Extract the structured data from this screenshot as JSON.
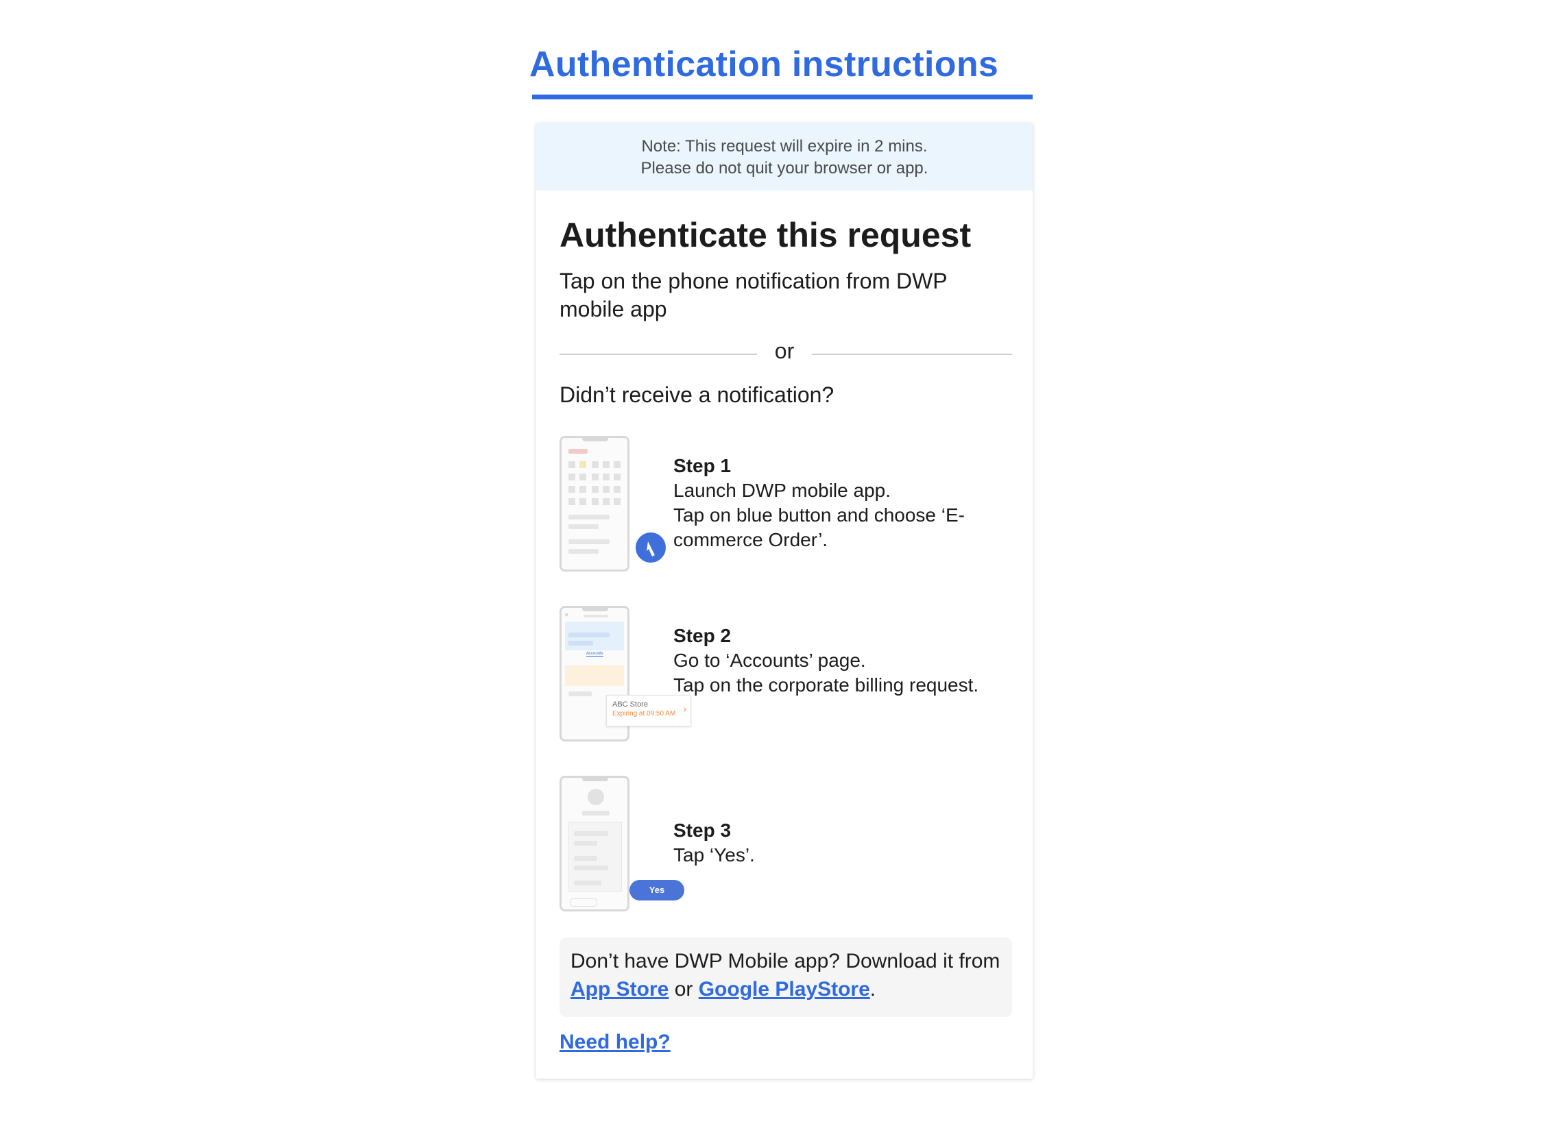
{
  "page": {
    "title": "Authentication instructions"
  },
  "note": {
    "line1": "Note: This request will expire in 2 mins.",
    "line2": "Please do not quit your browser or app."
  },
  "card": {
    "heading": "Authenticate this request",
    "subheading": "Tap on the phone notification from DWP mobile app",
    "divider": "or",
    "question": "Didn’t receive a notification?"
  },
  "steps": [
    {
      "title": "Step 1",
      "lines": [
        "Launch DWP mobile app.",
        "Tap on blue button and choose ‘E-commerce Order’."
      ]
    },
    {
      "title": "Step 2",
      "lines": [
        "Go to ‘Accounts’ page.",
        "Tap on the corporate billing request."
      ],
      "illustration": {
        "tab_label": "Accounts",
        "card_title": "ABC Store",
        "card_subtitle": "Expiring at 09:50 AM",
        "card_chevron": "›"
      }
    },
    {
      "title": "Step 3",
      "lines": [
        "Tap ‘Yes’."
      ],
      "illustration": {
        "button_label": "Yes"
      }
    }
  ],
  "download": {
    "text_before": "Don’t have DWP Mobile app? Download it from",
    "app_store": "App Store",
    "or": "or",
    "play_store": "Google PlayStore",
    "period": "."
  },
  "help": {
    "label": "Need help?"
  },
  "colors": {
    "accent": "#2f6ae0",
    "note_background": "#eaf5fd",
    "download_background": "#f5f5f5",
    "expiry_orange": "#f08a3c"
  }
}
